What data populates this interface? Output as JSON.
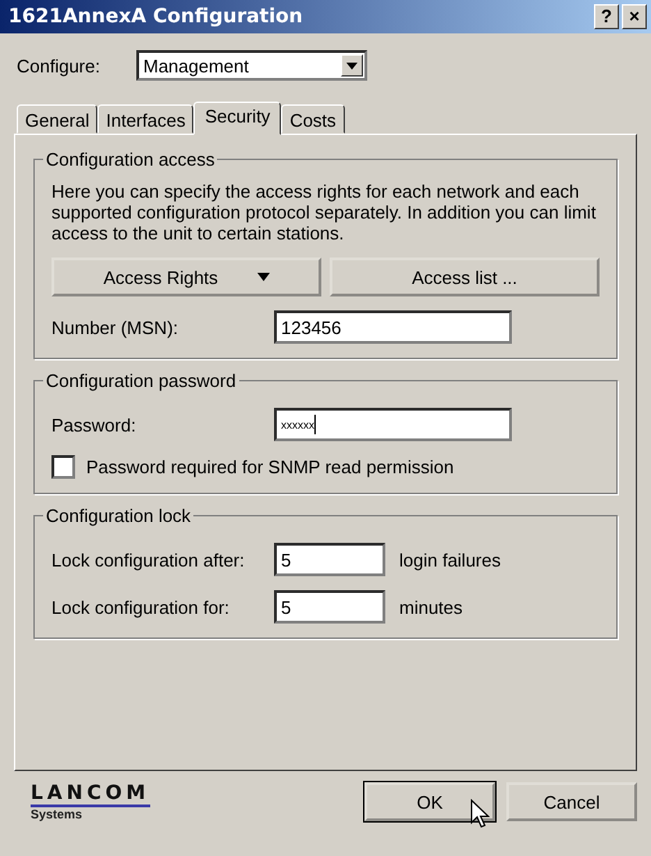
{
  "window": {
    "title": "1621AnnexA Configuration",
    "help_button": "?",
    "close_button": "×"
  },
  "configure": {
    "label": "Configure:",
    "value": "Management"
  },
  "tabs": [
    {
      "label": "General",
      "selected": false
    },
    {
      "label": "Interfaces",
      "selected": false
    },
    {
      "label": "Security",
      "selected": true
    },
    {
      "label": "Costs",
      "selected": false
    }
  ],
  "configuration_access": {
    "title": "Configuration access",
    "description": "Here you can specify the access rights for each network and each supported configuration protocol separately. In addition you can limit access to the unit to certain stations.",
    "access_rights_button": "Access Rights",
    "access_list_button": "Access list ...",
    "number_label": "Number (MSN):",
    "number_value": "123456"
  },
  "configuration_password": {
    "title": "Configuration password",
    "password_label": "Password:",
    "password_value": "xxxxxx",
    "snmp_checkbox": {
      "label": "Password required for SNMP read permission",
      "checked": false
    }
  },
  "configuration_lock": {
    "title": "Configuration lock",
    "rows": [
      {
        "label": "Lock configuration after:",
        "value": "5",
        "unit": "login failures"
      },
      {
        "label": "Lock configuration for:",
        "value": "5",
        "unit": "minutes"
      }
    ]
  },
  "logo": {
    "name": "LANCOM",
    "subtitle": "Systems"
  },
  "buttons": [
    {
      "label": "OK"
    },
    {
      "label": "Cancel"
    }
  ]
}
